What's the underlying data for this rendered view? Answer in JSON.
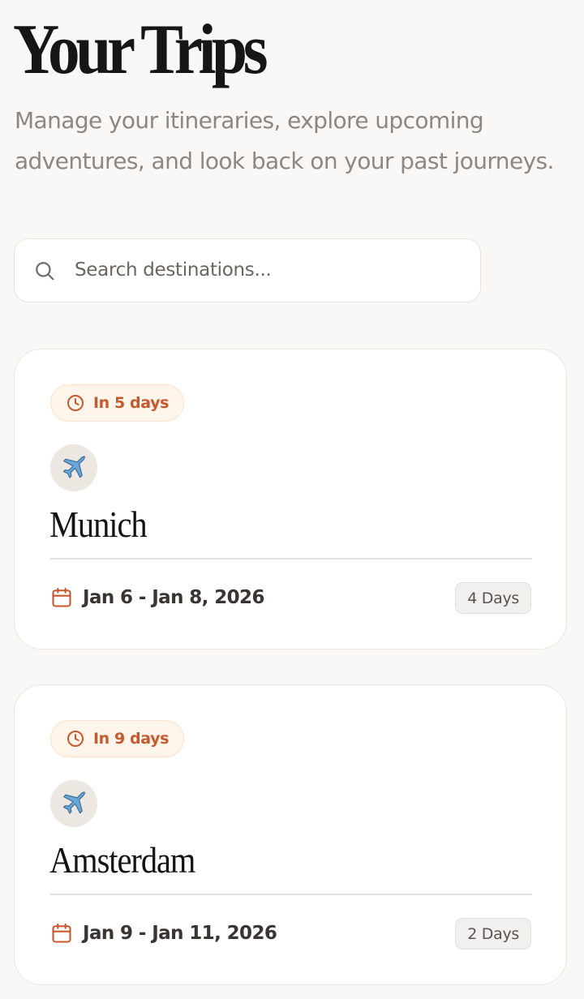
{
  "header": {
    "title": "Your Trips",
    "subtitle": "Manage your itineraries, explore upcoming adventures, and look back on your past journeys."
  },
  "search": {
    "placeholder": "Search destinations...",
    "value": ""
  },
  "colors": {
    "accent": "#c8582e",
    "badge_bg": "#fff5eb",
    "page_bg": "#faf8f6"
  },
  "trips": [
    {
      "countdown": "In 5 days",
      "icon": "airplane-icon",
      "name": "Munich",
      "dates": "Jan 6 - Jan 8, 2026",
      "duration": "4 Days"
    },
    {
      "countdown": "In 9 days",
      "icon": "airplane-icon",
      "name": "Amsterdam",
      "dates": "Jan 9 - Jan 11, 2026",
      "duration": "2 Days"
    }
  ]
}
